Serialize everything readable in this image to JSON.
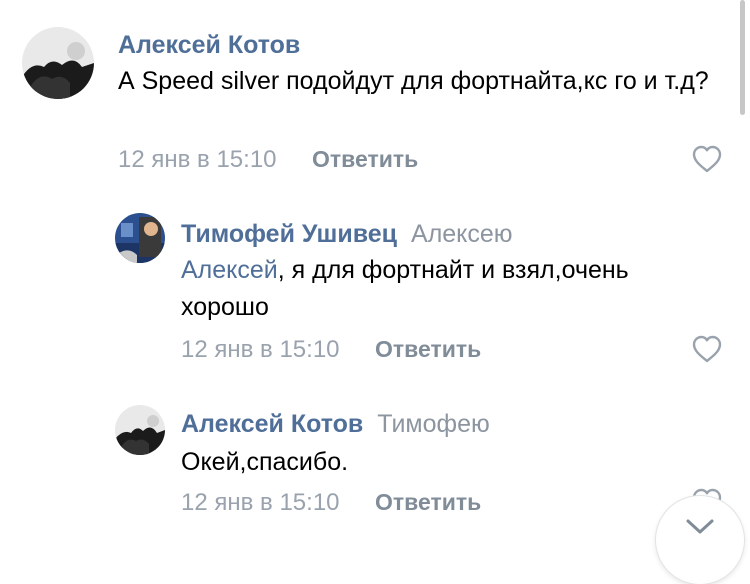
{
  "comments": [
    {
      "author": "Алексей Котов",
      "reply_to": "",
      "mention": "",
      "text": "А Speed silver подойдут для фортнайта,кс го и т.д?",
      "date": "12 янв в 15:10",
      "reply_label": "Ответить",
      "avatar_icon": "user-photo-dark"
    },
    {
      "author": "Тимофей Ушивец",
      "reply_to": "Алексею",
      "mention": "Алексей",
      "text": ", я для фортнайт и взял,очень хорошо",
      "date": "12 янв в 15:10",
      "reply_label": "Ответить",
      "avatar_icon": "user-photo-blue"
    },
    {
      "author": "Алексей Котов",
      "reply_to": "Тимофею",
      "mention": "",
      "text": "Окей,спасибо.",
      "date": "12 янв в 15:10",
      "reply_label": "Ответить",
      "avatar_icon": "user-photo-dark"
    }
  ],
  "icons": {
    "like": "heart-outline-icon",
    "scroll_down": "chevron-down-icon"
  },
  "colors": {
    "author": "#4f6f99",
    "mention": "#4f6f99",
    "secondary": "#99a2ad",
    "reply_button": "#818c99",
    "text": "#000000"
  }
}
